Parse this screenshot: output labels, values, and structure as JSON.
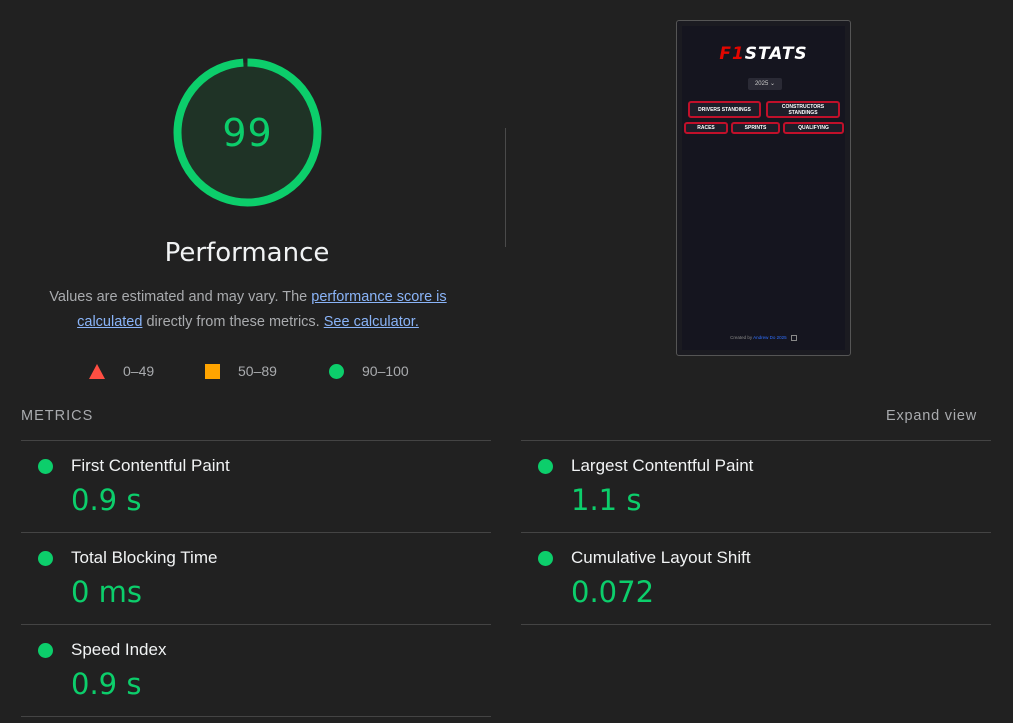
{
  "score": {
    "value": "99",
    "fraction": 0.99,
    "title": "Performance",
    "ring_color": "#0cce6b"
  },
  "description": {
    "prefix": "Values are estimated and may vary. The ",
    "link1": "performance score is calculated",
    "middle": " directly from these metrics. ",
    "link2": "See calculator."
  },
  "legend": {
    "fail": {
      "range": "0–49",
      "icon": "red-triangle-icon",
      "color": "#ff4e42"
    },
    "average": {
      "range": "50–89",
      "icon": "orange-square-icon",
      "color": "#ffa400"
    },
    "pass": {
      "range": "90–100",
      "icon": "green-circle-icon",
      "color": "#0cce6b"
    }
  },
  "preview": {
    "logo_red": "F1",
    "logo_white": "STATS",
    "year": "2025 ⌄",
    "buttons": [
      "DRIVERS STANDINGS",
      "CONSTRUCTORS STANDINGS",
      "RACES",
      "SPRINTS",
      "QUALIFYING"
    ],
    "credit_prefix": "Created by ",
    "credit_name": "Andrew Do 2025",
    "linkedin_icon": "linkedin-icon"
  },
  "metrics": {
    "header": "METRICS",
    "expand_label": "Expand view",
    "items": [
      {
        "label": "First Contentful Paint",
        "value": "0.9 s"
      },
      {
        "label": "Largest Contentful Paint",
        "value": "1.1 s"
      },
      {
        "label": "Total Blocking Time",
        "value": "0 ms"
      },
      {
        "label": "Cumulative Layout Shift",
        "value": "0.072"
      },
      {
        "label": "Speed Index",
        "value": "0.9 s"
      }
    ]
  }
}
